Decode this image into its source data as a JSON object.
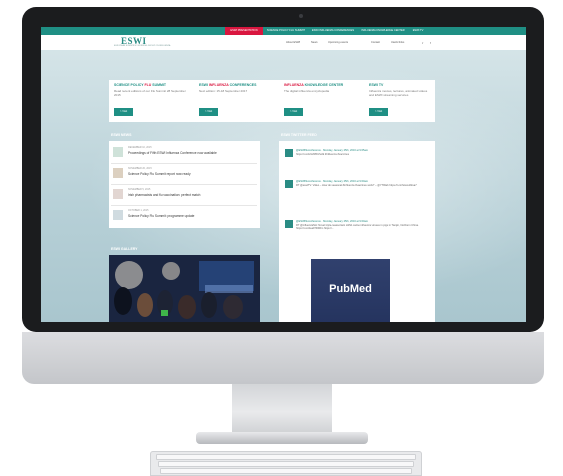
{
  "top_nav": {
    "items": [
      "ESWI PRESENTATION",
      "SCIENCE POLICY FLU SUMMIT",
      "ESWI INFLUENZA CONFERENCES",
      "INFLUENZA KNOWLEDGE CENTER",
      "ESWI TV"
    ]
  },
  "header": {
    "logo": "ESWI",
    "logo_sub": "EUROPEAN SCIENTIFIC WORKING GROUP ON INFLUENZA",
    "nav": [
      "About ESWI",
      "News",
      "Upcoming events",
      "Contact",
      "Useful links"
    ],
    "social": [
      "twitter-icon",
      "facebook-icon"
    ]
  },
  "cards": [
    {
      "title_a": "SCIENCE POLICY ",
      "title_b": "FLU",
      "title_c": " SUMMIT",
      "text": "Read recent editions of our Flu Summit 28 September 2015",
      "button": "> Visit"
    },
    {
      "title_a": "ESWI ",
      "title_b": "INFLUENZA",
      "title_c": " CONFERENCES",
      "text": "Next edition: 15-18 September 2017",
      "button": "> Visit"
    },
    {
      "title_a": "",
      "title_b": "INFLUENZA",
      "title_c": " KNOWLEDGE CENTER",
      "text": "The digital influenza encyclopedia",
      "button": "> Visit"
    },
    {
      "title_a": "ESWI TV",
      "title_b": "",
      "title_c": "",
      "text": "Influenza movies, lectures, animated videos and ESWI streaming services",
      "button": "> Visit"
    }
  ],
  "news": {
    "title": "ESWI NEWS",
    "items": [
      {
        "date": "DECEMBER 10, 2015",
        "title": "Proceedings of Fifth ESWI Influenza Conference now available"
      },
      {
        "date": "NOVEMBER 20, 2015",
        "title": "Science Policy Flu Summit report now ready"
      },
      {
        "date": "NOVEMBER 5, 2015",
        "title": "Irish pharmacists and flu vaccination: perfect match"
      },
      {
        "date": "OCTOBER 1, 2015",
        "title": "Science Policy Flu Summit: programme update"
      }
    ]
  },
  "gallery": {
    "title": "ESWI GALLERY"
  },
  "twitter": {
    "title": "ESWI TWITTER FEED",
    "tweets": [
      {
        "head": "@ESWIfluconference · Monday, January 25th, 2016 at 9:05am",
        "body": "https://t.co/t2c2RWVw2k #influenza #vaccines"
      },
      {
        "head": "@ESWIfluconference · Monday, January 25th, 2016 at 9:00am",
        "body": "RT @eswiTV: Video – How do seasonal #influenza #vaccines work? – @YTRlab https://t.co/hzewu62ua7"
      },
      {
        "head": "@ESWIfluconference · Monday, January 25th, 2016 at 9:00am",
        "body": "RT @influenzaNH: Novel triple-reassortant H1N1 swine influenza viruses in pigs in Tianjin, Northern China. https://t.co/2ea97DDtfm https://..."
      }
    ],
    "image_label": "PubMed"
  },
  "colors": {
    "accent": "#1f8f84",
    "active": "#d9163f",
    "red": "#d9163f"
  }
}
